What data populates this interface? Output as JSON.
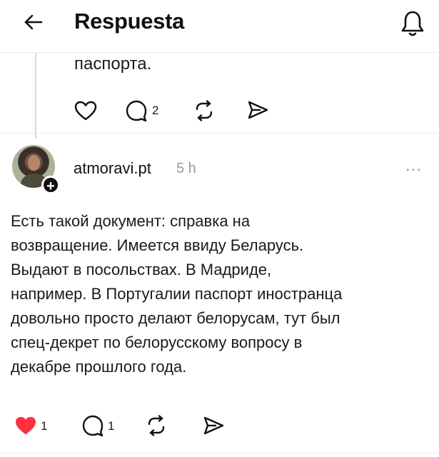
{
  "header": {
    "title": "Respuesta",
    "back_icon": "arrow-left-icon",
    "bell_icon": "bell-icon"
  },
  "previous_post": {
    "text_tail": "паспорта.",
    "actions": {
      "reply_count": "2"
    }
  },
  "post": {
    "username": "atmoravi.pt",
    "time": "5 h",
    "more": "...",
    "lines": [
      "Есть такой документ: справка на",
      "возвращение. Имеется ввиду Беларусь.",
      "Выдают в посольствах. В Мадриде,",
      "например. В Португалии паспорт иностранца",
      "довольно просто делают белорусам, тут был",
      "спец-декрет по белорусскому вопросу в",
      "декабре прошлого года."
    ],
    "actions": {
      "like_count": "1",
      "reply_count": "1",
      "liked": true
    }
  },
  "colors": {
    "like_active": "#ff3040",
    "muted": "#9a9a9a",
    "separator": "#ececec"
  }
}
